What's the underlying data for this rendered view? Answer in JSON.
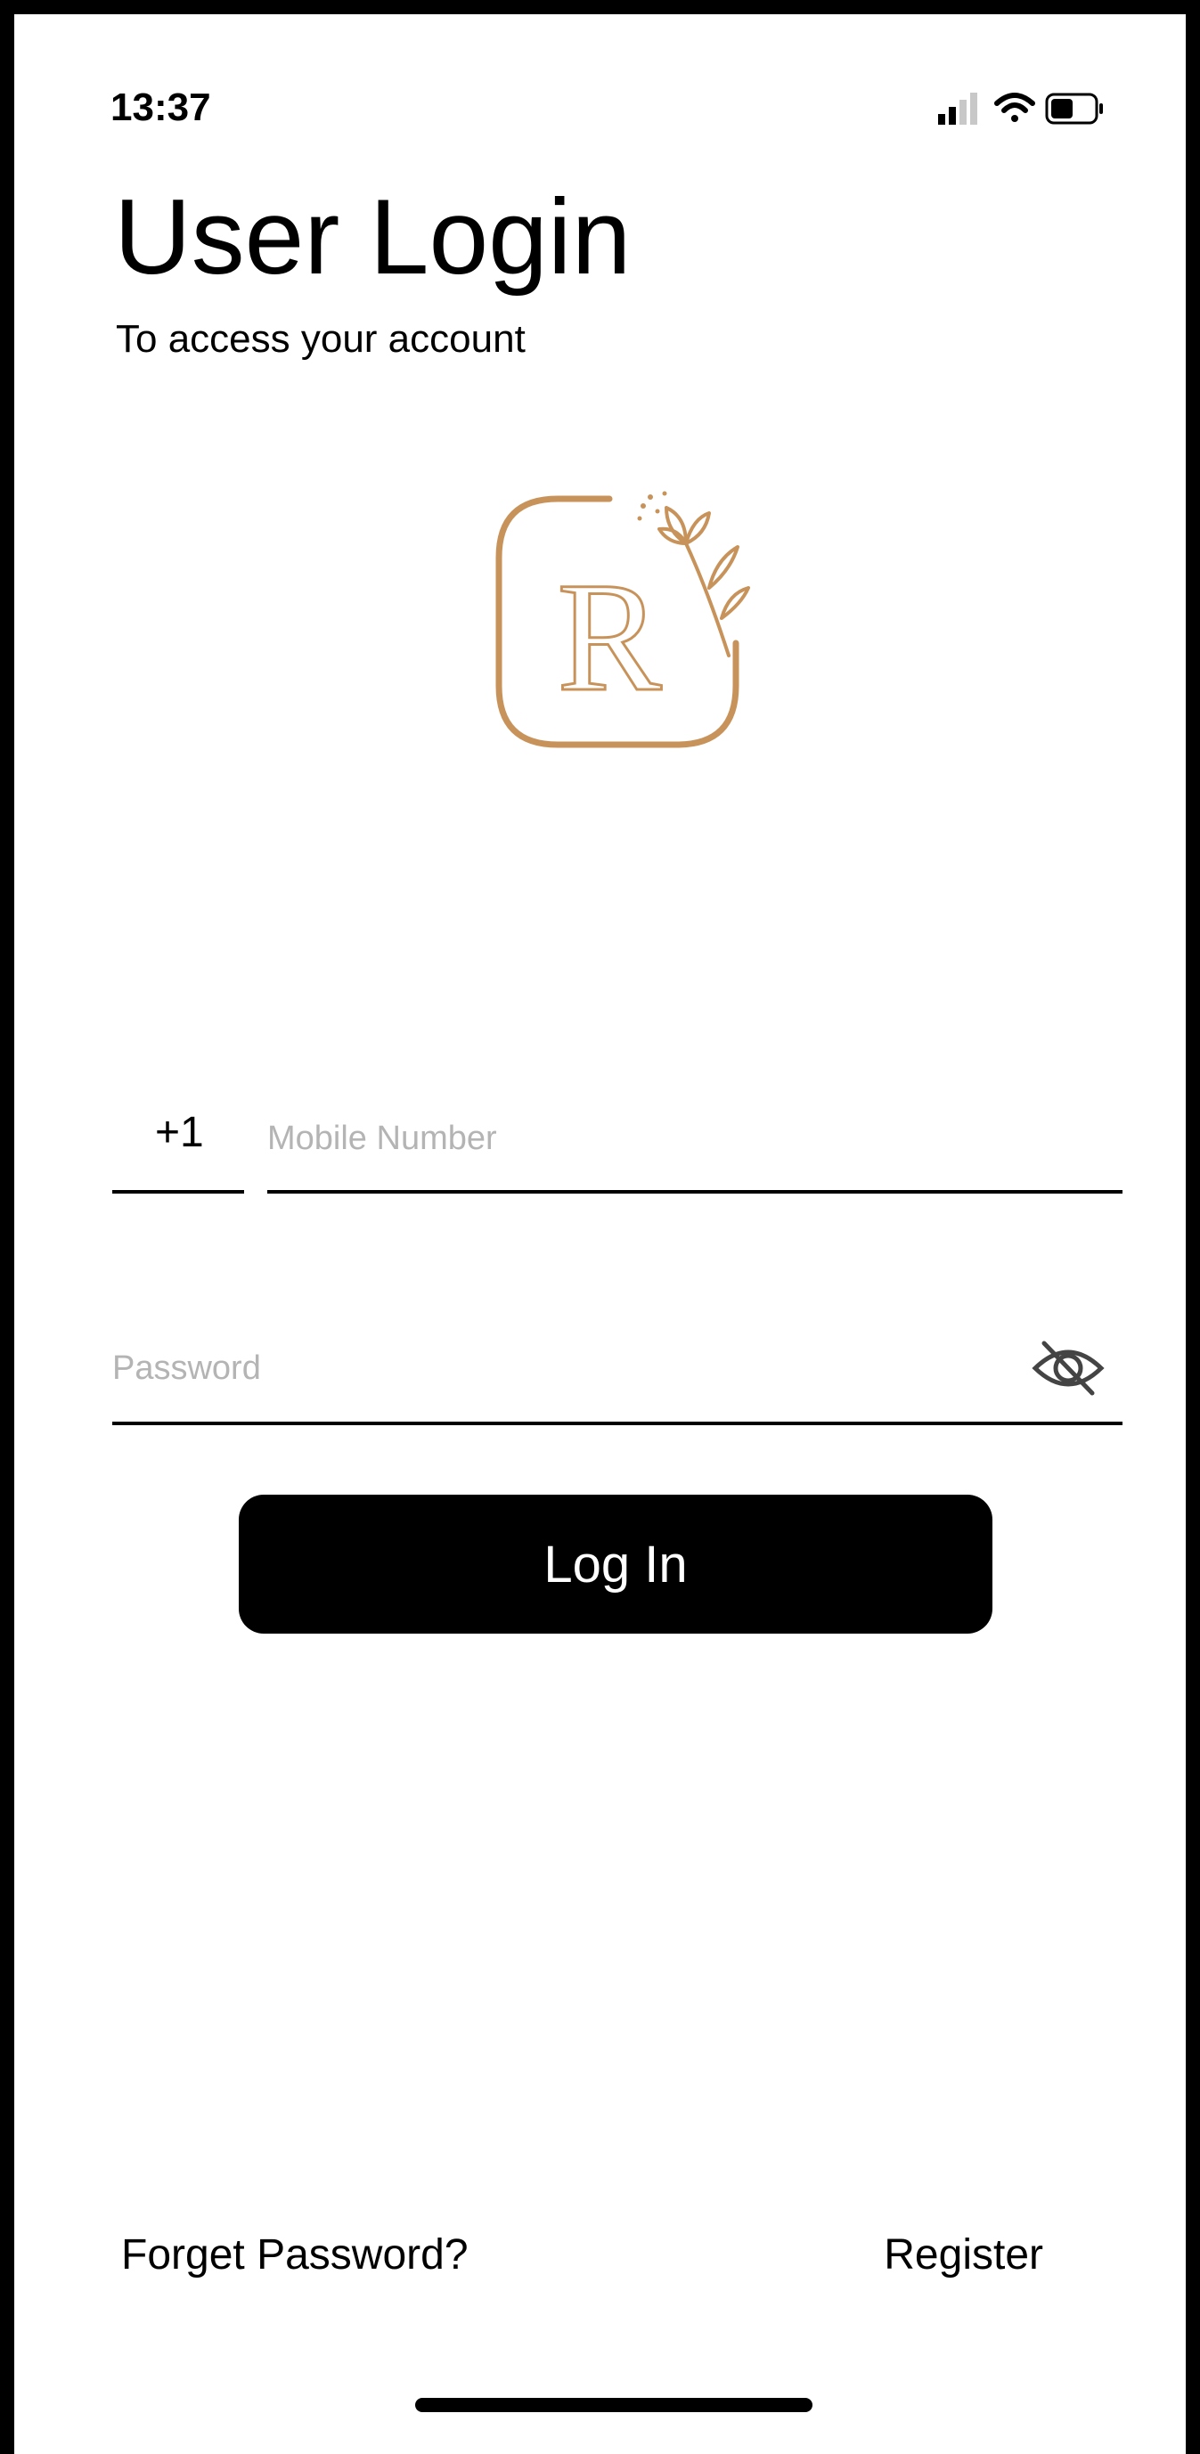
{
  "status_bar": {
    "time": "13:37",
    "icons": [
      "signal-icon",
      "wifi-icon",
      "battery-icon"
    ]
  },
  "header": {
    "title": "User Login",
    "subtitle": "To access your account"
  },
  "logo": {
    "letter": "R",
    "color": "#C8935A"
  },
  "form": {
    "country_code": "+1",
    "mobile_placeholder": "Mobile Number",
    "mobile_value": "",
    "password_placeholder": "Password",
    "password_value": "",
    "visibility_icon": "eye-slash-icon"
  },
  "actions": {
    "login_label": "Log In",
    "forget_label": "Forget Password?",
    "register_label": "Register"
  },
  "colors": {
    "accent": "#C8935A",
    "primary": "#000000",
    "placeholder": "#B4B4B4"
  }
}
